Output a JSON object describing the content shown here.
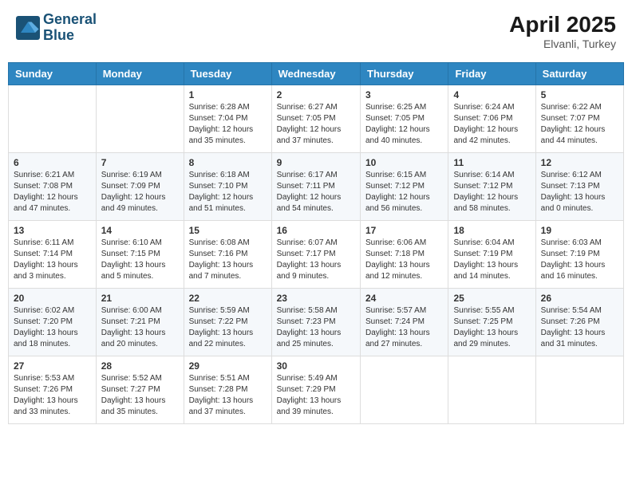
{
  "header": {
    "logo_line1": "General",
    "logo_line2": "Blue",
    "month_title": "April 2025",
    "location": "Elvanli, Turkey"
  },
  "weekdays": [
    "Sunday",
    "Monday",
    "Tuesday",
    "Wednesday",
    "Thursday",
    "Friday",
    "Saturday"
  ],
  "weeks": [
    [
      {
        "day": "",
        "info": ""
      },
      {
        "day": "",
        "info": ""
      },
      {
        "day": "1",
        "info": "Sunrise: 6:28 AM\nSunset: 7:04 PM\nDaylight: 12 hours\nand 35 minutes."
      },
      {
        "day": "2",
        "info": "Sunrise: 6:27 AM\nSunset: 7:05 PM\nDaylight: 12 hours\nand 37 minutes."
      },
      {
        "day": "3",
        "info": "Sunrise: 6:25 AM\nSunset: 7:05 PM\nDaylight: 12 hours\nand 40 minutes."
      },
      {
        "day": "4",
        "info": "Sunrise: 6:24 AM\nSunset: 7:06 PM\nDaylight: 12 hours\nand 42 minutes."
      },
      {
        "day": "5",
        "info": "Sunrise: 6:22 AM\nSunset: 7:07 PM\nDaylight: 12 hours\nand 44 minutes."
      }
    ],
    [
      {
        "day": "6",
        "info": "Sunrise: 6:21 AM\nSunset: 7:08 PM\nDaylight: 12 hours\nand 47 minutes."
      },
      {
        "day": "7",
        "info": "Sunrise: 6:19 AM\nSunset: 7:09 PM\nDaylight: 12 hours\nand 49 minutes."
      },
      {
        "day": "8",
        "info": "Sunrise: 6:18 AM\nSunset: 7:10 PM\nDaylight: 12 hours\nand 51 minutes."
      },
      {
        "day": "9",
        "info": "Sunrise: 6:17 AM\nSunset: 7:11 PM\nDaylight: 12 hours\nand 54 minutes."
      },
      {
        "day": "10",
        "info": "Sunrise: 6:15 AM\nSunset: 7:12 PM\nDaylight: 12 hours\nand 56 minutes."
      },
      {
        "day": "11",
        "info": "Sunrise: 6:14 AM\nSunset: 7:12 PM\nDaylight: 12 hours\nand 58 minutes."
      },
      {
        "day": "12",
        "info": "Sunrise: 6:12 AM\nSunset: 7:13 PM\nDaylight: 13 hours\nand 0 minutes."
      }
    ],
    [
      {
        "day": "13",
        "info": "Sunrise: 6:11 AM\nSunset: 7:14 PM\nDaylight: 13 hours\nand 3 minutes."
      },
      {
        "day": "14",
        "info": "Sunrise: 6:10 AM\nSunset: 7:15 PM\nDaylight: 13 hours\nand 5 minutes."
      },
      {
        "day": "15",
        "info": "Sunrise: 6:08 AM\nSunset: 7:16 PM\nDaylight: 13 hours\nand 7 minutes."
      },
      {
        "day": "16",
        "info": "Sunrise: 6:07 AM\nSunset: 7:17 PM\nDaylight: 13 hours\nand 9 minutes."
      },
      {
        "day": "17",
        "info": "Sunrise: 6:06 AM\nSunset: 7:18 PM\nDaylight: 13 hours\nand 12 minutes."
      },
      {
        "day": "18",
        "info": "Sunrise: 6:04 AM\nSunset: 7:19 PM\nDaylight: 13 hours\nand 14 minutes."
      },
      {
        "day": "19",
        "info": "Sunrise: 6:03 AM\nSunset: 7:19 PM\nDaylight: 13 hours\nand 16 minutes."
      }
    ],
    [
      {
        "day": "20",
        "info": "Sunrise: 6:02 AM\nSunset: 7:20 PM\nDaylight: 13 hours\nand 18 minutes."
      },
      {
        "day": "21",
        "info": "Sunrise: 6:00 AM\nSunset: 7:21 PM\nDaylight: 13 hours\nand 20 minutes."
      },
      {
        "day": "22",
        "info": "Sunrise: 5:59 AM\nSunset: 7:22 PM\nDaylight: 13 hours\nand 22 minutes."
      },
      {
        "day": "23",
        "info": "Sunrise: 5:58 AM\nSunset: 7:23 PM\nDaylight: 13 hours\nand 25 minutes."
      },
      {
        "day": "24",
        "info": "Sunrise: 5:57 AM\nSunset: 7:24 PM\nDaylight: 13 hours\nand 27 minutes."
      },
      {
        "day": "25",
        "info": "Sunrise: 5:55 AM\nSunset: 7:25 PM\nDaylight: 13 hours\nand 29 minutes."
      },
      {
        "day": "26",
        "info": "Sunrise: 5:54 AM\nSunset: 7:26 PM\nDaylight: 13 hours\nand 31 minutes."
      }
    ],
    [
      {
        "day": "27",
        "info": "Sunrise: 5:53 AM\nSunset: 7:26 PM\nDaylight: 13 hours\nand 33 minutes."
      },
      {
        "day": "28",
        "info": "Sunrise: 5:52 AM\nSunset: 7:27 PM\nDaylight: 13 hours\nand 35 minutes."
      },
      {
        "day": "29",
        "info": "Sunrise: 5:51 AM\nSunset: 7:28 PM\nDaylight: 13 hours\nand 37 minutes."
      },
      {
        "day": "30",
        "info": "Sunrise: 5:49 AM\nSunset: 7:29 PM\nDaylight: 13 hours\nand 39 minutes."
      },
      {
        "day": "",
        "info": ""
      },
      {
        "day": "",
        "info": ""
      },
      {
        "day": "",
        "info": ""
      }
    ]
  ]
}
